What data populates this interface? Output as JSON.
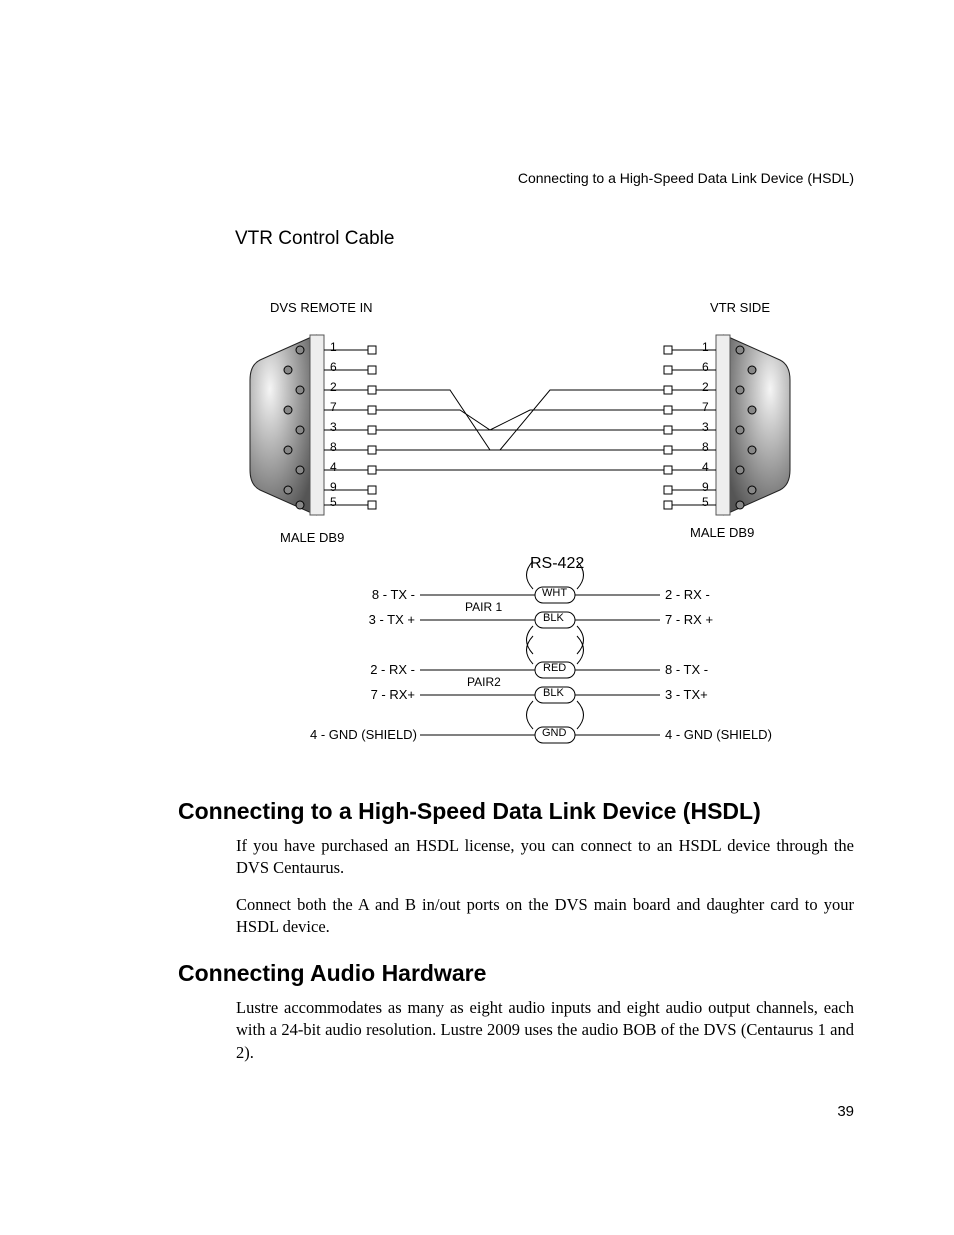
{
  "running_head": "Connecting to a High-Speed Data Link Device (HSDL)",
  "figure_caption": "VTR Control Cable",
  "page_number": "39",
  "diagram": {
    "left_title": "DVS REMOTE IN",
    "right_title": "VTR SIDE",
    "left_conn": "MALE DB9",
    "right_conn": "MALE DB9",
    "protocol": "RS-422",
    "pins_left": [
      "1",
      "6",
      "2",
      "7",
      "3",
      "8",
      "4",
      "9",
      "5"
    ],
    "pins_right": [
      "1",
      "6",
      "2",
      "7",
      "3",
      "8",
      "4",
      "9",
      "5"
    ],
    "pair1_label": "PAIR 1",
    "pair2_label": "PAIR2",
    "rows": [
      {
        "left": "8 - TX -",
        "wire": "WHT",
        "right": "2 - RX -"
      },
      {
        "left": "3 - TX +",
        "wire": "BLK",
        "right": "7 - RX +"
      },
      {
        "left": "2 - RX -",
        "wire": "RED",
        "right": "8 - TX -"
      },
      {
        "left": "7 - RX+",
        "wire": "BLK",
        "right": "3 - TX+"
      },
      {
        "left": "4 - GND (SHIELD)",
        "wire": "GND",
        "right": "4 - GND (SHIELD)"
      }
    ]
  },
  "section1": {
    "title": "Connecting to a High-Speed Data Link Device (HSDL)",
    "p1": "If you have purchased an HSDL license, you can connect to an HSDL device through the DVS Centaurus.",
    "p2": "Connect both the A and B in/out ports on the DVS main board and daughter card to your HSDL device."
  },
  "section2": {
    "title": "Connecting Audio Hardware",
    "p1": "Lustre accommodates as many as eight audio inputs and eight audio output channels, each with a 24-bit audio resolution. Lustre 2009 uses the audio BOB of the DVS (Centaurus 1 and 2)."
  }
}
